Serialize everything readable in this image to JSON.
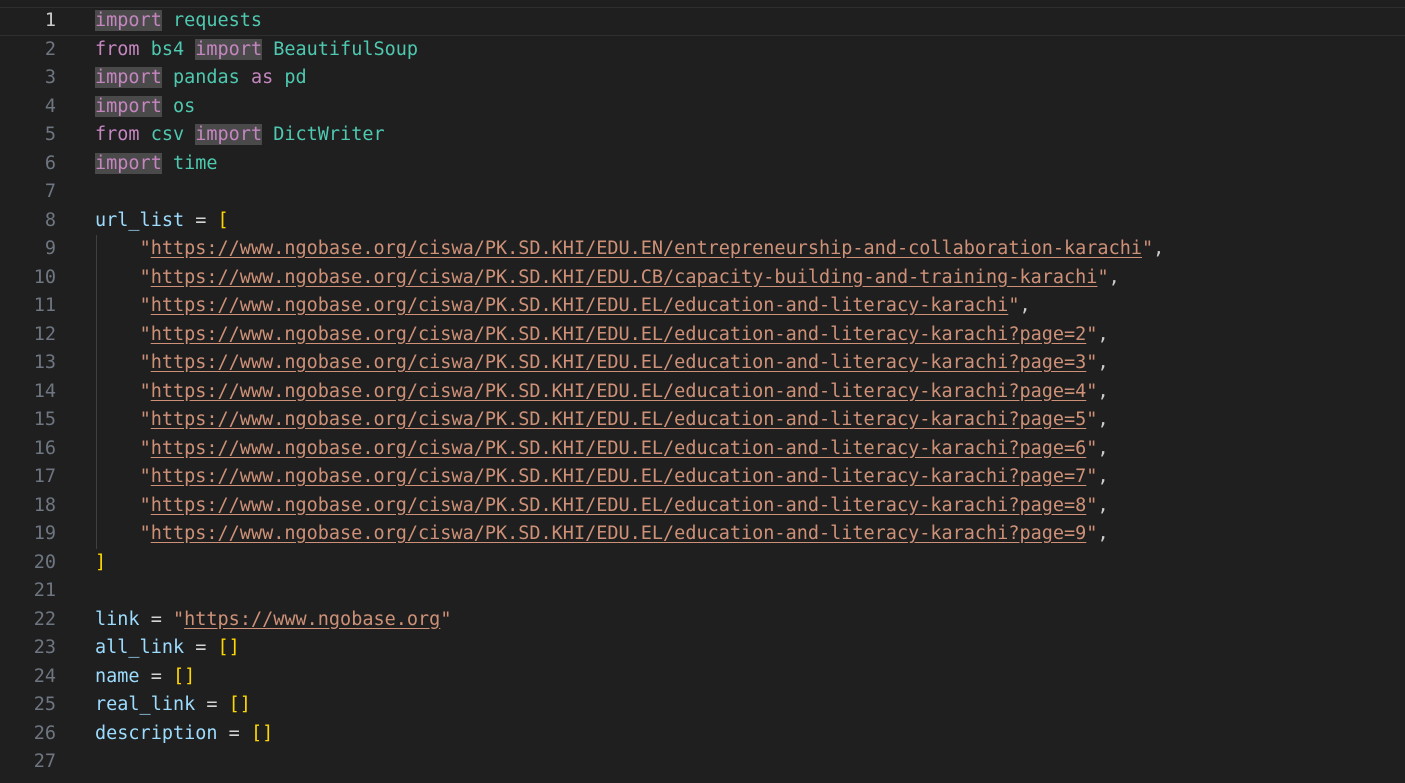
{
  "editor": {
    "active_line": 1,
    "imports": [
      {
        "kw1": "",
        "name": "requests",
        "kw2": "",
        "alias_kw": "",
        "alias": ""
      },
      {
        "kw1": "from",
        "name": "bs4",
        "kw2": "import",
        "alias_kw": "",
        "alias": "BeautifulSoup"
      },
      {
        "kw1": "",
        "name": "pandas",
        "kw2": "",
        "alias_kw": "as",
        "alias": "pd"
      },
      {
        "kw1": "",
        "name": "os",
        "kw2": "",
        "alias_kw": "",
        "alias": ""
      },
      {
        "kw1": "from",
        "name": "csv",
        "kw2": "import",
        "alias_kw": "",
        "alias": "DictWriter"
      },
      {
        "kw1": "",
        "name": "time",
        "kw2": "",
        "alias_kw": "",
        "alias": ""
      }
    ],
    "import_kw": "import",
    "url_list_var": "url_list",
    "url_list": [
      "https://www.ngobase.org/ciswa/PK.SD.KHI/EDU.EN/entrepreneurship-and-collaboration-karachi",
      "https://www.ngobase.org/ciswa/PK.SD.KHI/EDU.CB/capacity-building-and-training-karachi",
      "https://www.ngobase.org/ciswa/PK.SD.KHI/EDU.EL/education-and-literacy-karachi",
      "https://www.ngobase.org/ciswa/PK.SD.KHI/EDU.EL/education-and-literacy-karachi?page=2",
      "https://www.ngobase.org/ciswa/PK.SD.KHI/EDU.EL/education-and-literacy-karachi?page=3",
      "https://www.ngobase.org/ciswa/PK.SD.KHI/EDU.EL/education-and-literacy-karachi?page=4",
      "https://www.ngobase.org/ciswa/PK.SD.KHI/EDU.EL/education-and-literacy-karachi?page=5",
      "https://www.ngobase.org/ciswa/PK.SD.KHI/EDU.EL/education-and-literacy-karachi?page=6",
      "https://www.ngobase.org/ciswa/PK.SD.KHI/EDU.EL/education-and-literacy-karachi?page=7",
      "https://www.ngobase.org/ciswa/PK.SD.KHI/EDU.EL/education-and-literacy-karachi?page=8",
      "https://www.ngobase.org/ciswa/PK.SD.KHI/EDU.EL/education-and-literacy-karachi?page=9"
    ],
    "link_var": "link",
    "link_value": "https://www.ngobase.org",
    "empty_lists": [
      "all_link",
      "name",
      "real_link",
      "description"
    ],
    "line_numbers": [
      "1",
      "2",
      "3",
      "4",
      "5",
      "6",
      "7",
      "8",
      "9",
      "10",
      "11",
      "12",
      "13",
      "14",
      "15",
      "16",
      "17",
      "18",
      "19",
      "20",
      "21",
      "22",
      "23",
      "24",
      "25",
      "26",
      "27"
    ]
  }
}
